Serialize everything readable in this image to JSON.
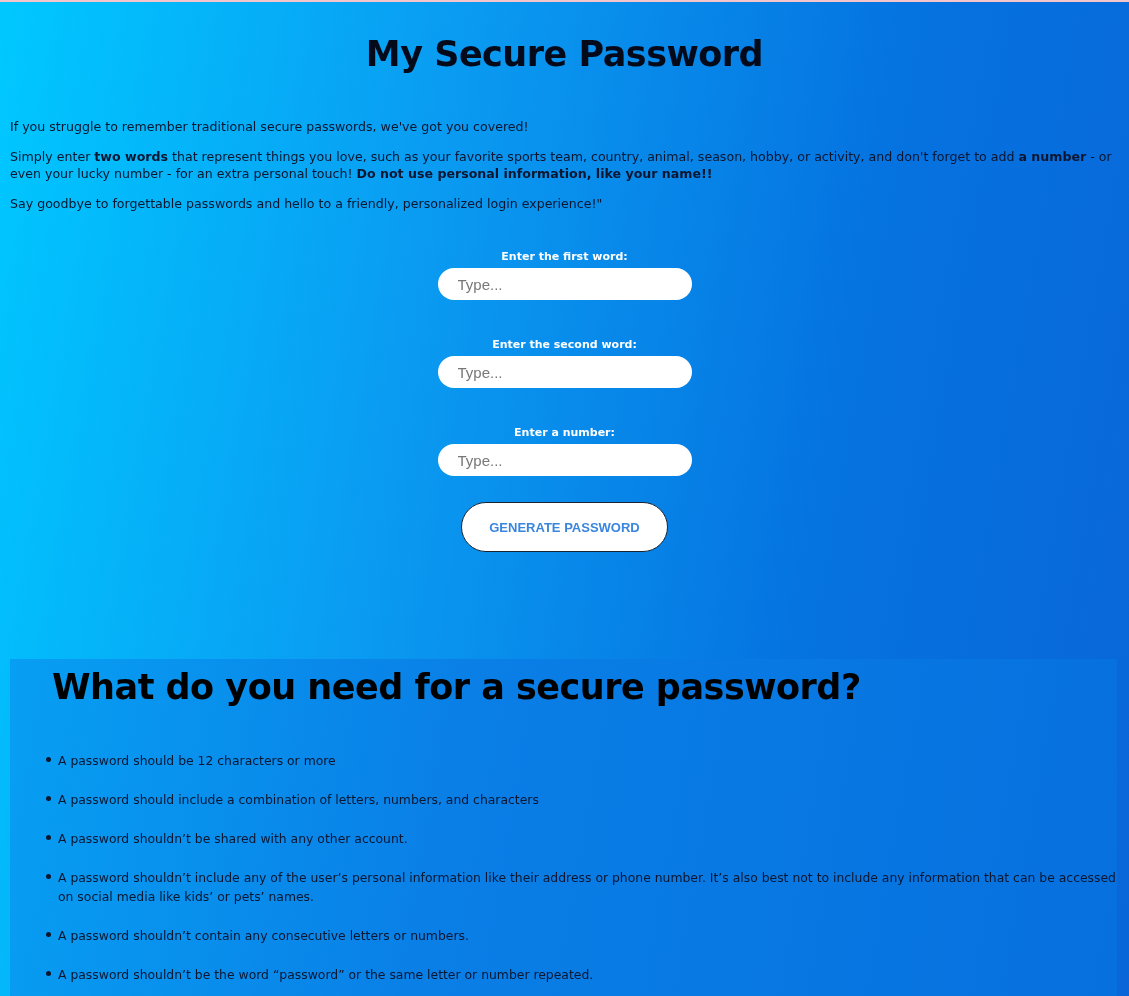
{
  "title": "My Secure Password",
  "intro": [
    "If you struggle to remember traditional secure passwords, we've got you covered!",
    "Simply enter **two words** that represent things you love, such as your favorite sports team, country, animal, season, hobby, or activity, and don't forget to add **a number** - or even your lucky number - for an extra personal touch! **Do not use personal information, like your name!!**",
    "Say goodbye to forgettable passwords and hello to a friendly, personalized login experience!\""
  ],
  "fields": [
    {
      "label": "Enter the first word:",
      "placeholder": "Type..."
    },
    {
      "label": "Enter the second word:",
      "placeholder": "Type..."
    },
    {
      "label": "Enter a number:",
      "placeholder": "Type..."
    }
  ],
  "button": "GENERATE PASSWORD",
  "tips": {
    "heading": "What do you need for a secure password?",
    "items": [
      "A password should be 12 characters or more",
      "A password should include a combination of letters, numbers, and characters",
      "A password shouldn’t be shared with any other account.",
      "A password shouldn’t include any of the user’s personal information like their address or phone number. It’s also best not to include any information that can be accessed on social media like kids’ or pets’ names.",
      "A password shouldn’t contain any consecutive letters or numbers.",
      "A password shouldn’t be the word “password” or the same letter or number repeated."
    ]
  }
}
